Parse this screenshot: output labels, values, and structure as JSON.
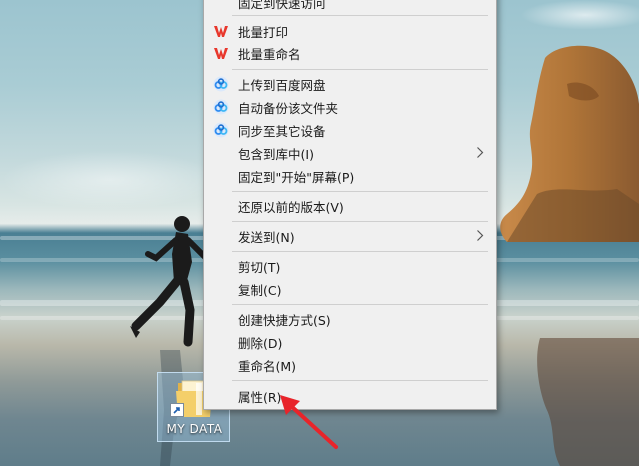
{
  "desktop": {
    "icon_label": "MY DATA"
  },
  "context_menu": {
    "items": [
      {
        "label": "固定到快速访问"
      },
      {
        "label": "批量打印"
      },
      {
        "label": "批量重命名"
      },
      {
        "label": "上传到百度网盘"
      },
      {
        "label": "自动备份该文件夹"
      },
      {
        "label": "同步至其它设备"
      },
      {
        "label": "包含到库中(I)"
      },
      {
        "label": "固定到\"开始\"屏幕(P)"
      },
      {
        "label": "还原以前的版本(V)"
      },
      {
        "label": "发送到(N)"
      },
      {
        "label": "剪切(T)"
      },
      {
        "label": "复制(C)"
      },
      {
        "label": "创建快捷方式(S)"
      },
      {
        "label": "删除(D)"
      },
      {
        "label": "重命名(M)"
      },
      {
        "label": "属性(R)"
      }
    ]
  },
  "icons": {
    "wps": "wps-logo-icon",
    "baidu": "baidu-netdisk-icon",
    "submenu": "chevron-right-icon",
    "folder": "folder-icon",
    "shortcut": "shortcut-arrow-icon"
  },
  "colors": {
    "wps_red": "#e8372c",
    "baidu_blue": "#2f8cf0",
    "annotation_red": "#e8242a",
    "menu_bg": "#f0f0f0"
  }
}
